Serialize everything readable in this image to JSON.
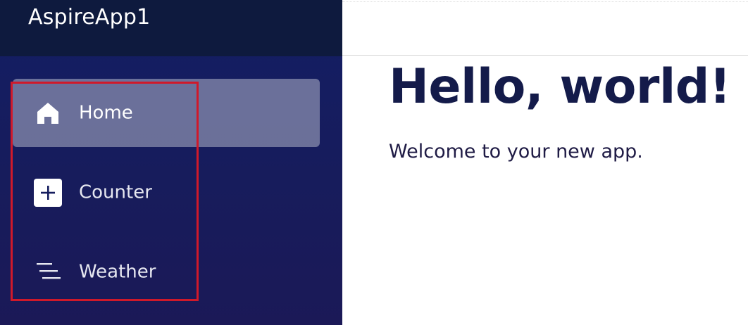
{
  "app": {
    "brand": "AspireApp1"
  },
  "nav": {
    "items": [
      {
        "label": "Home",
        "icon": "home-icon",
        "active": true
      },
      {
        "label": "Counter",
        "icon": "plus-square-icon",
        "active": false
      },
      {
        "label": "Weather",
        "icon": "list-lines-icon",
        "active": false
      }
    ]
  },
  "main": {
    "title": "Hello, world!",
    "subtitle": "Welcome to your new app."
  },
  "colors": {
    "sidebar_top": "#131e64",
    "sidebar_bottom": "#1b1957",
    "brand_bar": "#0e1a3e",
    "highlight_border": "#d0192a",
    "title_text": "#141b4a"
  }
}
